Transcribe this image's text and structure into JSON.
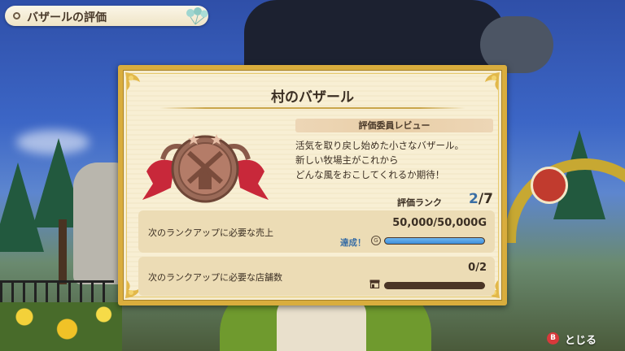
{
  "header": {
    "title": "バザールの評価"
  },
  "panel": {
    "title": "村のバザール",
    "review_header": "評価委員レビュー",
    "review_text": "活気を取り戻し始めた小さなバザール。\n新しい牧場主がこれから\nどんな風をおこしてくれるか期待！",
    "rank": {
      "label": "評価ランク",
      "current": "2",
      "separator": "/",
      "total": "7"
    },
    "sales": {
      "label": "次のランクアップに必要な売上",
      "value": "50,000/50,000G",
      "achieved_label": "達成！",
      "coin_glyph": "G",
      "progress_fraction": 1.0
    },
    "shops": {
      "label": "次のランクアップに必要な店舗数",
      "value": "0/2",
      "progress_fraction": 0.0
    }
  },
  "footer": {
    "close_button_glyph": "B",
    "close_label": "とじる"
  },
  "colors": {
    "accent_blue": "#3b6fa5",
    "gold_border": "#d9ad3d",
    "panel_bg": "#f8efd4",
    "close_red": "#d8393b"
  },
  "icons": [
    "medal-windmill-icon",
    "coin-icon",
    "shop-icon",
    "balloons-icon",
    "b-button-icon"
  ]
}
